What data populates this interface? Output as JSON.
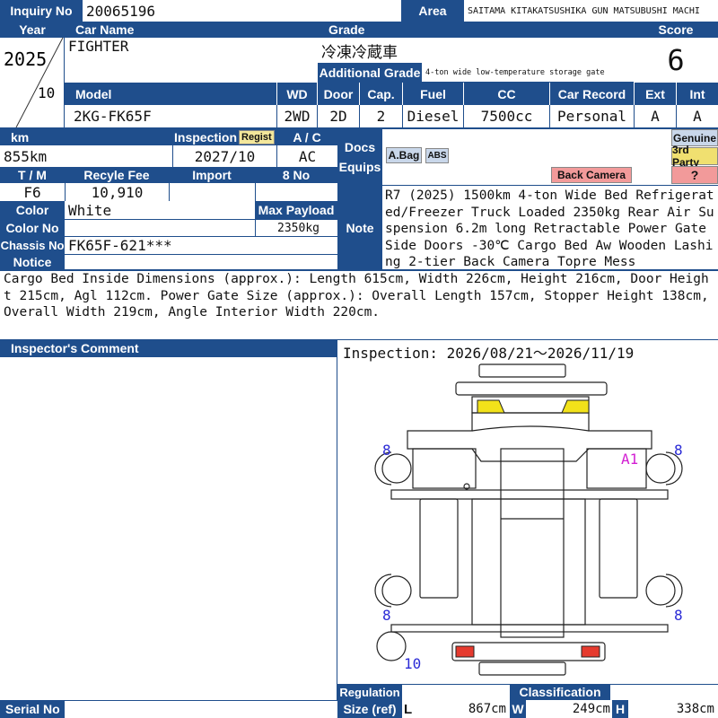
{
  "inquiry": {
    "label": "Inquiry No",
    "value": "20065196"
  },
  "area": {
    "label": "Area",
    "value": "SAITAMA KITAKATSUSHIKA GUN MATSUBUSHI MACHI"
  },
  "year": {
    "label": "Year",
    "value": "2025",
    "month": "10"
  },
  "car_name": {
    "label": "Car Name",
    "value": "FIGHTER"
  },
  "grade": {
    "label": "Grade",
    "value": "冷凍冷蔵車",
    "additional_label": "Additional Grade",
    "additional_value": "4-ton wide low-temperature storage gate"
  },
  "score": {
    "label": "Score",
    "value": "6"
  },
  "specs": {
    "labels": {
      "model": "Model",
      "wd": "WD",
      "door": "Door",
      "cap": "Cap.",
      "fuel": "Fuel",
      "cc": "CC",
      "car_record": "Car Record",
      "ext": "Ext",
      "int": "Int"
    },
    "values": {
      "model": "2KG-FK65F",
      "wd": "2WD",
      "door": "2D",
      "cap": "2",
      "fuel": "Diesel",
      "cc": "7500cc",
      "car_record": "Personal",
      "ext": "A",
      "int": "A"
    }
  },
  "km": {
    "label": "km",
    "value": "855km"
  },
  "inspection_exp": {
    "label": "Inspection",
    "badge": "Regist",
    "value": "2027/10"
  },
  "ac": {
    "label": "A / C",
    "value": "AC"
  },
  "tm": {
    "label": "T / M",
    "value": "F6"
  },
  "recycle": {
    "label": "Recyle Fee",
    "value": "10,910"
  },
  "import": {
    "label": "Import",
    "value": ""
  },
  "owners": {
    "label": "8 No",
    "value": ""
  },
  "color": {
    "label": "Color",
    "value": "White"
  },
  "color_no": {
    "label": "Color No",
    "value": ""
  },
  "max_payload": {
    "label": "Max Payload",
    "value": "2350kg"
  },
  "chassis": {
    "label": "Chassis No",
    "value": "FK65F-621***"
  },
  "notice": {
    "label": "Notice"
  },
  "docs": {
    "label": "Docs",
    "label2": "Equips"
  },
  "equips": {
    "abag": "A.Bag",
    "abs": "ABS",
    "back_camera": "Back Camera"
  },
  "genuine": {
    "genuine": "Genuine",
    "third_party": "3rd Party",
    "unknown": "?"
  },
  "note": {
    "label": "Note",
    "text": "R7 (2025) 1500km 4-ton Wide Bed Refrigerated/Freezer Truck Loaded 2350kg Rear Air Suspension 6.2m long Retractable Power Gate Side Doors -30℃ Cargo Bed Aw Wooden Lashing 2-tier Back Camera Topre Mess"
  },
  "notice_text": "Cargo Bed Inside Dimensions (approx.): Length 615cm, Width 226cm, Height 216cm, Door Height 215cm, Agl 112cm. Power Gate Size (approx.): Overall Length 157cm, Stopper Height 138cm, Overall Width 219cm, Angle Interior Width 220cm.",
  "inspector_comment": {
    "label": "Inspector's Comment",
    "value": ""
  },
  "inspection_period": "Inspection: 2026/08/21～2026/11/19",
  "diagram": {
    "tire_labels": [
      "8",
      "8",
      "8",
      "8",
      "10"
    ],
    "damage_mark": "A1",
    "colors": {
      "line": "#222",
      "yellow": "#f2e21a",
      "red": "#e53a2e",
      "tire_num": "#2b2bd6",
      "damage": "#d21fd2"
    }
  },
  "serial": {
    "label": "Serial No",
    "value": ""
  },
  "regulation": {
    "label": "Regulation"
  },
  "classification": {
    "label": "Classification"
  },
  "size": {
    "label": "Size (ref)",
    "l_label": "L",
    "l_value": "867cm",
    "w_label": "W",
    "w_value": "249cm",
    "h_label": "H",
    "h_value": "338cm"
  },
  "colors": {
    "header_blue": "#1f4e8c",
    "regist_badge": "#f3e79b",
    "back_camera": "#f29a9a",
    "genuine": "#c9d7ea",
    "third_party": "#f0e070",
    "unknown": "#f29a9a",
    "equip_badge": "#c9d7ea"
  }
}
